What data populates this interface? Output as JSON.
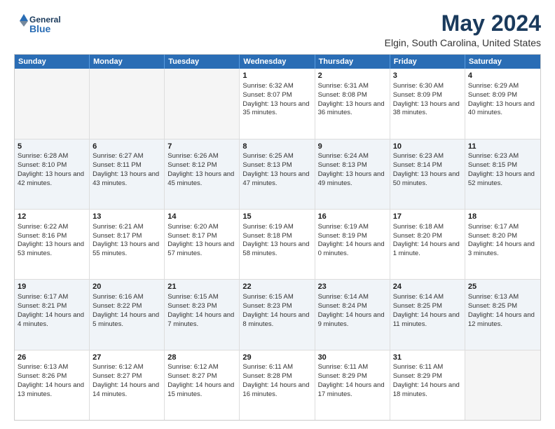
{
  "header": {
    "logo_line1": "General",
    "logo_line2": "Blue",
    "main_title": "May 2024",
    "subtitle": "Elgin, South Carolina, United States"
  },
  "days_of_week": [
    "Sunday",
    "Monday",
    "Tuesday",
    "Wednesday",
    "Thursday",
    "Friday",
    "Saturday"
  ],
  "weeks": [
    [
      {
        "day": "",
        "empty": true
      },
      {
        "day": "",
        "empty": true
      },
      {
        "day": "",
        "empty": true
      },
      {
        "day": "1",
        "sunrise": "Sunrise: 6:32 AM",
        "sunset": "Sunset: 8:07 PM",
        "daylight": "Daylight: 13 hours and 35 minutes."
      },
      {
        "day": "2",
        "sunrise": "Sunrise: 6:31 AM",
        "sunset": "Sunset: 8:08 PM",
        "daylight": "Daylight: 13 hours and 36 minutes."
      },
      {
        "day": "3",
        "sunrise": "Sunrise: 6:30 AM",
        "sunset": "Sunset: 8:09 PM",
        "daylight": "Daylight: 13 hours and 38 minutes."
      },
      {
        "day": "4",
        "sunrise": "Sunrise: 6:29 AM",
        "sunset": "Sunset: 8:09 PM",
        "daylight": "Daylight: 13 hours and 40 minutes."
      }
    ],
    [
      {
        "day": "5",
        "sunrise": "Sunrise: 6:28 AM",
        "sunset": "Sunset: 8:10 PM",
        "daylight": "Daylight: 13 hours and 42 minutes."
      },
      {
        "day": "6",
        "sunrise": "Sunrise: 6:27 AM",
        "sunset": "Sunset: 8:11 PM",
        "daylight": "Daylight: 13 hours and 43 minutes."
      },
      {
        "day": "7",
        "sunrise": "Sunrise: 6:26 AM",
        "sunset": "Sunset: 8:12 PM",
        "daylight": "Daylight: 13 hours and 45 minutes."
      },
      {
        "day": "8",
        "sunrise": "Sunrise: 6:25 AM",
        "sunset": "Sunset: 8:13 PM",
        "daylight": "Daylight: 13 hours and 47 minutes."
      },
      {
        "day": "9",
        "sunrise": "Sunrise: 6:24 AM",
        "sunset": "Sunset: 8:13 PM",
        "daylight": "Daylight: 13 hours and 49 minutes."
      },
      {
        "day": "10",
        "sunrise": "Sunrise: 6:23 AM",
        "sunset": "Sunset: 8:14 PM",
        "daylight": "Daylight: 13 hours and 50 minutes."
      },
      {
        "day": "11",
        "sunrise": "Sunrise: 6:23 AM",
        "sunset": "Sunset: 8:15 PM",
        "daylight": "Daylight: 13 hours and 52 minutes."
      }
    ],
    [
      {
        "day": "12",
        "sunrise": "Sunrise: 6:22 AM",
        "sunset": "Sunset: 8:16 PM",
        "daylight": "Daylight: 13 hours and 53 minutes."
      },
      {
        "day": "13",
        "sunrise": "Sunrise: 6:21 AM",
        "sunset": "Sunset: 8:17 PM",
        "daylight": "Daylight: 13 hours and 55 minutes."
      },
      {
        "day": "14",
        "sunrise": "Sunrise: 6:20 AM",
        "sunset": "Sunset: 8:17 PM",
        "daylight": "Daylight: 13 hours and 57 minutes."
      },
      {
        "day": "15",
        "sunrise": "Sunrise: 6:19 AM",
        "sunset": "Sunset: 8:18 PM",
        "daylight": "Daylight: 13 hours and 58 minutes."
      },
      {
        "day": "16",
        "sunrise": "Sunrise: 6:19 AM",
        "sunset": "Sunset: 8:19 PM",
        "daylight": "Daylight: 14 hours and 0 minutes."
      },
      {
        "day": "17",
        "sunrise": "Sunrise: 6:18 AM",
        "sunset": "Sunset: 8:20 PM",
        "daylight": "Daylight: 14 hours and 1 minute."
      },
      {
        "day": "18",
        "sunrise": "Sunrise: 6:17 AM",
        "sunset": "Sunset: 8:20 PM",
        "daylight": "Daylight: 14 hours and 3 minutes."
      }
    ],
    [
      {
        "day": "19",
        "sunrise": "Sunrise: 6:17 AM",
        "sunset": "Sunset: 8:21 PM",
        "daylight": "Daylight: 14 hours and 4 minutes."
      },
      {
        "day": "20",
        "sunrise": "Sunrise: 6:16 AM",
        "sunset": "Sunset: 8:22 PM",
        "daylight": "Daylight: 14 hours and 5 minutes."
      },
      {
        "day": "21",
        "sunrise": "Sunrise: 6:15 AM",
        "sunset": "Sunset: 8:23 PM",
        "daylight": "Daylight: 14 hours and 7 minutes."
      },
      {
        "day": "22",
        "sunrise": "Sunrise: 6:15 AM",
        "sunset": "Sunset: 8:23 PM",
        "daylight": "Daylight: 14 hours and 8 minutes."
      },
      {
        "day": "23",
        "sunrise": "Sunrise: 6:14 AM",
        "sunset": "Sunset: 8:24 PM",
        "daylight": "Daylight: 14 hours and 9 minutes."
      },
      {
        "day": "24",
        "sunrise": "Sunrise: 6:14 AM",
        "sunset": "Sunset: 8:25 PM",
        "daylight": "Daylight: 14 hours and 11 minutes."
      },
      {
        "day": "25",
        "sunrise": "Sunrise: 6:13 AM",
        "sunset": "Sunset: 8:25 PM",
        "daylight": "Daylight: 14 hours and 12 minutes."
      }
    ],
    [
      {
        "day": "26",
        "sunrise": "Sunrise: 6:13 AM",
        "sunset": "Sunset: 8:26 PM",
        "daylight": "Daylight: 14 hours and 13 minutes."
      },
      {
        "day": "27",
        "sunrise": "Sunrise: 6:12 AM",
        "sunset": "Sunset: 8:27 PM",
        "daylight": "Daylight: 14 hours and 14 minutes."
      },
      {
        "day": "28",
        "sunrise": "Sunrise: 6:12 AM",
        "sunset": "Sunset: 8:27 PM",
        "daylight": "Daylight: 14 hours and 15 minutes."
      },
      {
        "day": "29",
        "sunrise": "Sunrise: 6:11 AM",
        "sunset": "Sunset: 8:28 PM",
        "daylight": "Daylight: 14 hours and 16 minutes."
      },
      {
        "day": "30",
        "sunrise": "Sunrise: 6:11 AM",
        "sunset": "Sunset: 8:29 PM",
        "daylight": "Daylight: 14 hours and 17 minutes."
      },
      {
        "day": "31",
        "sunrise": "Sunrise: 6:11 AM",
        "sunset": "Sunset: 8:29 PM",
        "daylight": "Daylight: 14 hours and 18 minutes."
      },
      {
        "day": "",
        "empty": true
      }
    ]
  ]
}
